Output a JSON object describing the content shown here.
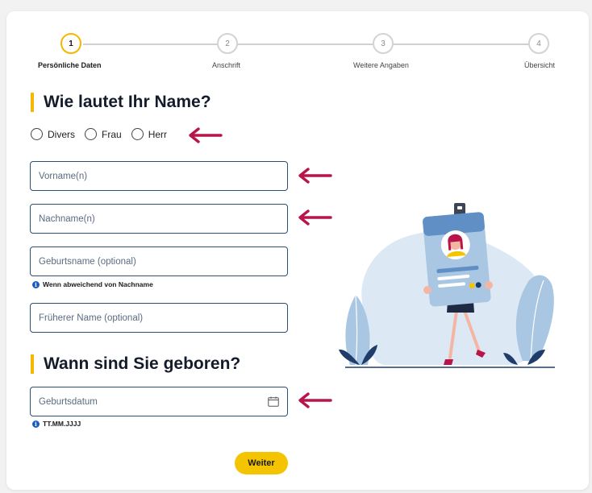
{
  "stepper": {
    "steps": [
      {
        "number": "1",
        "label": "Persönliche Daten"
      },
      {
        "number": "2",
        "label": "Anschrift"
      },
      {
        "number": "3",
        "label": "Weitere Angaben"
      },
      {
        "number": "4",
        "label": "Übersicht"
      }
    ]
  },
  "name_section": {
    "title": "Wie lautet Ihr Name?",
    "salutations": [
      "Divers",
      "Frau",
      "Herr"
    ],
    "first_name_placeholder": "Vorname(n)",
    "last_name_placeholder": "Nachname(n)",
    "birth_name_placeholder": "Geburtsname (optional)",
    "birth_name_hint": "Wenn abweichend von Nachname",
    "former_name_placeholder": "Früherer Name (optional)"
  },
  "birth_section": {
    "title": "Wann sind Sie geboren?",
    "birthdate_placeholder": "Geburtsdatum",
    "birthdate_hint": "TT.MM.JJJJ"
  },
  "actions": {
    "next_label": "Weiter"
  },
  "icons": {
    "info": "info-icon",
    "calendar": "calendar-icon",
    "arrow": "arrow-left-icon"
  },
  "colors": {
    "accent": "#f5b800",
    "field_border": "#2c4f76",
    "arrow": "#b8154a",
    "info": "#1b5dbf"
  }
}
